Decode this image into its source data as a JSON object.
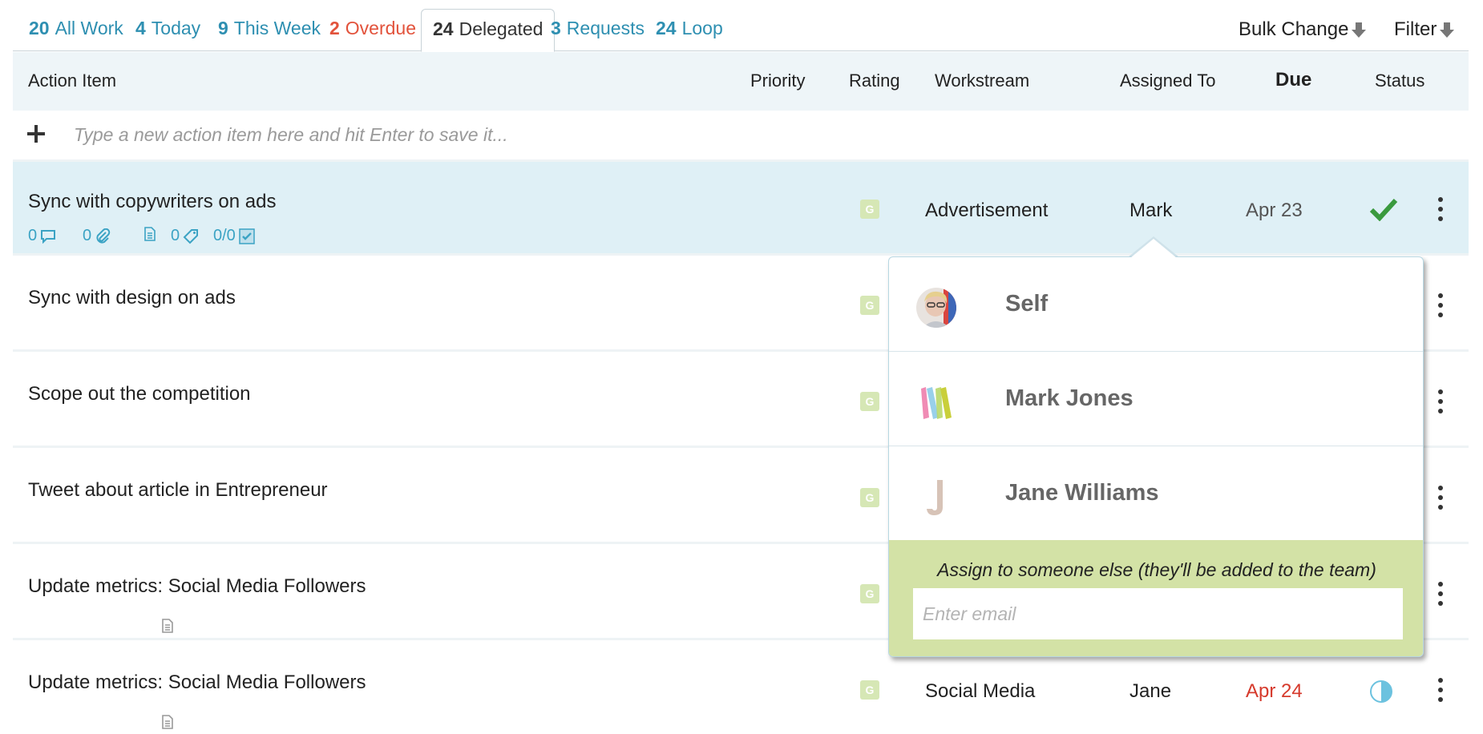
{
  "tabs": [
    {
      "count": "20",
      "label": "All Work"
    },
    {
      "count": "4",
      "label": "Today"
    },
    {
      "count": "9",
      "label": "This Week"
    },
    {
      "count": "2",
      "label": "Overdue"
    },
    {
      "count": "24",
      "label": "Delegated"
    },
    {
      "count": "3",
      "label": "Requests"
    },
    {
      "count": "24",
      "label": "Loop"
    }
  ],
  "active_tab": "Delegated",
  "toolbar": {
    "bulk_change": "Bulk Change",
    "filter": "Filter"
  },
  "columns": {
    "action_item": "Action Item",
    "priority": "Priority",
    "rating": "Rating",
    "workstream": "Workstream",
    "assigned_to": "Assigned To",
    "due": "Due",
    "status": "Status"
  },
  "new_item": {
    "placeholder": "Type a new action item here and hit Enter to save it..."
  },
  "rows": [
    {
      "title": "Sync with copywriters on ads",
      "rating": "G",
      "workstream": "Advertisement",
      "assignee": "Mark",
      "due": "Apr 23",
      "status": "done",
      "meta": {
        "comments": "0",
        "attachments": "0",
        "tags": "0",
        "checklist": "0/0"
      }
    },
    {
      "title": "Sync with design on ads",
      "rating": "G"
    },
    {
      "title": "Scope out the competition",
      "rating": "G"
    },
    {
      "title": "Tweet about article in Entrepreneur",
      "rating": "G"
    },
    {
      "title": "Update metrics: Social Media Followers",
      "rating": "G"
    },
    {
      "title": "Update metrics: Social Media Followers",
      "rating": "G",
      "workstream": "Social Media",
      "assignee": "Jane",
      "due": "Apr 24",
      "status": "in-progress"
    }
  ],
  "assign_popup": {
    "options": [
      {
        "name": "Self",
        "avatar": "photo-avatar"
      },
      {
        "name": "Mark Jones",
        "avatar": "m-letter-avatar"
      },
      {
        "name": "Jane Williams",
        "avatar": "j-letter-avatar"
      }
    ],
    "else_label": "Assign to someone else (they'll be added to the team)",
    "email_placeholder": "Enter email"
  },
  "colors": {
    "accent": "#2e8fb1",
    "overdue": "#e2523b",
    "selected_row": "#dff0f6",
    "header_bg": "#eef5f8",
    "popup_footer": "#d3e2a6",
    "check": "#3a9a3e"
  }
}
